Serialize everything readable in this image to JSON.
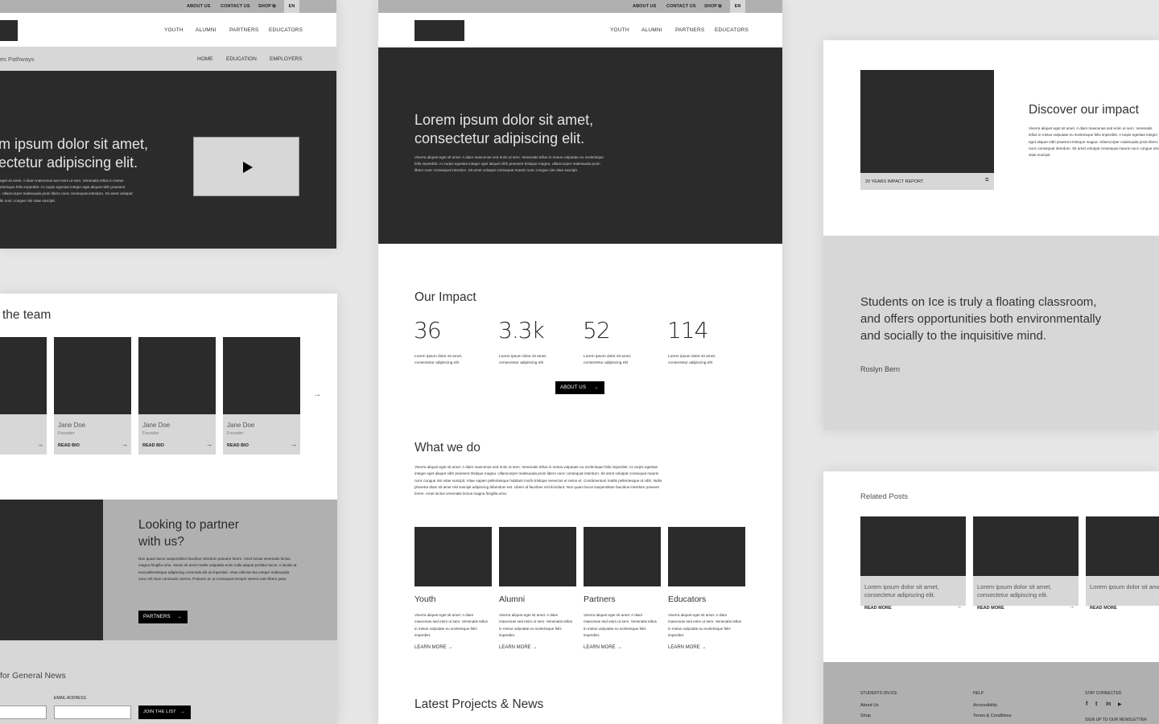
{
  "utility_nav": {
    "about": "ABOUT US",
    "contact": "CONTACT US",
    "shop": "SHOP",
    "shop_icon": "external-link-icon",
    "lang": "EN"
  },
  "main_nav": [
    "YOUTH",
    "ALUMNI",
    "PARTNERS",
    "EDUCATORS"
  ],
  "left": {
    "subnav_title": "es Pathways",
    "subnav": [
      "HOME",
      "EDUCATION",
      "EMPLOYERS"
    ],
    "hero": {
      "title_line1": "m ipsum dolor sit amet,",
      "title_line2": "ectetur adipiscing elit.",
      "body": [
        "eget sit amet. A diam maecenas sed enim ut sem. Venenatis tellus in metus",
        "elerisque felis imperdiet. Ac turpis egestas integer eget aliquet nibh praesent",
        ". Ullamcorper malesuada proin libero nunc consequat interdum. Sit amet volutpat",
        "lis nunc congue nisi vitae suscipit."
      ],
      "video_icon": "play-icon"
    },
    "team": {
      "title": "the team",
      "members": [
        {
          "name": "",
          "role": "",
          "link": ""
        },
        {
          "name": "Jane Doe",
          "role": "Founder",
          "link": "READ BIO"
        },
        {
          "name": "Jane Doe",
          "role": "Founder",
          "link": "READ BIO"
        },
        {
          "name": "Jane Doe",
          "role": "Founder",
          "link": "READ BIO"
        }
      ],
      "arrow": "→",
      "next_icon": "→"
    },
    "partner": {
      "title_line1": "Looking to partner",
      "title_line2": "with us?",
      "body": "Non quam lacus suspendisse faucibus interdum posuere lorem. Amet luctus venenatis lectus magna fringilla urna. Varius sit amet mattis vulputate enim nulla aliquet porttitor lacus. A iaculis at erat pellentesque adipiscing commodo elit at imperdiet. Vitae ultricies leo integer malesuada nunc vel risus commodo viverra. Posuere ac ut consequat semper viverra nam libero justo.",
      "button": "PARTNERS"
    },
    "newsletter": {
      "title": "for General News",
      "email_label": "EMAIL ADDRESS",
      "email_value": "",
      "name_value": "",
      "button": "JOIN THE LIST"
    }
  },
  "middle": {
    "hero": {
      "title_line1": "Lorem ipsum dolor sit amet,",
      "title_line2": "consectetur adipiscing elit.",
      "body": "Viverra aliquet eget sit amet. A diam maecenas sed enim ut sem. Venenatis tellus in metus vulputate eu scelerisque felis imperdiet. Ac turpis egestas integer eget aliquet nibh praesent tristique magna. Ullamcorper malesuada proin libero nunc consequat interdum. Sit amet volutpat consequat mauris nunc congue nisi vitae suscipit."
    },
    "impact": {
      "title": "Our Impact",
      "stats": [
        {
          "value": "36",
          "desc": "Lorem ipsum dolor sit amet, consectetur adipiscing elit"
        },
        {
          "value": "3.3k",
          "desc": "Lorem ipsum dolor sit amet, consectetur adipiscing elit"
        },
        {
          "value": "52",
          "desc": "Lorem ipsum dolor sit amet, consectetur adipiscing elit"
        },
        {
          "value": "114",
          "desc": "Lorem ipsum dolor sit amet, consectetur adipiscing elit"
        }
      ],
      "button": "ABOUT US"
    },
    "what": {
      "title": "What we do",
      "body": "Viverra aliquet eget sit amet. A diam maecenas sed enim ut sem. Venenatis tellus in metus vulputate eu scelerisque felis imperdiet. Ac turpis egestas integer eget aliquet nibh praesent tristique magna. Ullamcorper malesuada proin libero nunc consequat interdum. Sit amet volutpat consequat mauris nunc congue nisi vitae suscipit. Vitae sapien pellentesque habitant morbi tristique senectus et netus et. Condimentum mattis pellentesque id nibh. Nulla pharetra diam sit amet nisl suscipit adipiscing bibendum est. Libero id faucibus nisl tincidunt. Non quam lacus suspendisse faucibus interdum posuere lorem. Amet luctus venenatis lectus magna fringilla urna.",
      "cards": [
        {
          "title": "Youth",
          "desc": "Viverra aliquet eget sit amet. A diam maecenas sed enim ut sem. Venenatis tellus in metus vulputate eu scelerisque felis imperdiet.",
          "link": "LEARN MORE →"
        },
        {
          "title": "Alumni",
          "desc": "Viverra aliquet eget sit amet. A diam maecenas sed enim ut sem. Venenatis tellus in metus vulputate eu scelerisque felis imperdiet.",
          "link": "LEARN MORE →"
        },
        {
          "title": "Partners",
          "desc": "Viverra aliquet eget sit amet. A diam maecenas sed enim ut sem. Venenatis tellus in metus vulputate eu scelerisque felis imperdiet.",
          "link": "LEARN MORE →"
        },
        {
          "title": "Educators",
          "desc": "Viverra aliquet eget sit amet. A diam maecenas sed enim ut sem. Venenatis tellus in metus vulputate eu scelerisque felis imperdiet.",
          "link": "LEARN MORE →"
        }
      ]
    },
    "latest_title": "Latest Projects & News"
  },
  "right": {
    "discover": {
      "report_label": "20 YEARS IMPACT REPORT",
      "report_icon": "external-link-icon",
      "title": "Discover our impact",
      "body": "Viverra aliquet eget sit amet. A diam maecenas sed enim ut sem. Venenatis tellus in metus vulputate eu scelerisque felis imperdiet. A turpis egestas integer eget aliquet nibh praesent tristique magna. Ullamcorper malesuada proin libero nunc consequat interdum. Sit amet volutpat consequat mauris nunc congue nisi vitae suscipit."
    },
    "quote": {
      "text": "Students on Ice is truly a floating classroom, and offers opportunities both environmentally and socially to the inquisitive mind.",
      "author": "Roslyn Bern"
    },
    "related": {
      "title": "Related Posts",
      "posts": [
        {
          "title": "Lorem ipsum dolor sit amet, consectetur adipiscing elit.",
          "link": "READ MORE"
        },
        {
          "title": "Lorem ipsum dolor sit amet, consectetur adipiscing elit.",
          "link": "READ MORE"
        },
        {
          "title": "Lorem ipsum dolor sit amet, consectetur adipiscing elit.",
          "link": "READ MORE"
        }
      ]
    },
    "footer": {
      "col1": {
        "heading": "STUDENTS ON ICE",
        "links": [
          "About Us",
          "Shop"
        ]
      },
      "col2": {
        "heading": "HELP",
        "links": [
          "Accessibility",
          "Terms & Conditions"
        ]
      },
      "col3": {
        "heading": "STAY CONNECTED",
        "social": [
          "f",
          "t",
          "in",
          "▶"
        ],
        "newsletter": "SIGN UP TO OUR NEWSLETTER"
      }
    }
  },
  "colors": {
    "dark": "#2b2b2b",
    "light": "#d7d7d7",
    "mid": "#b0b0b0",
    "background": "#e6e6e6"
  }
}
